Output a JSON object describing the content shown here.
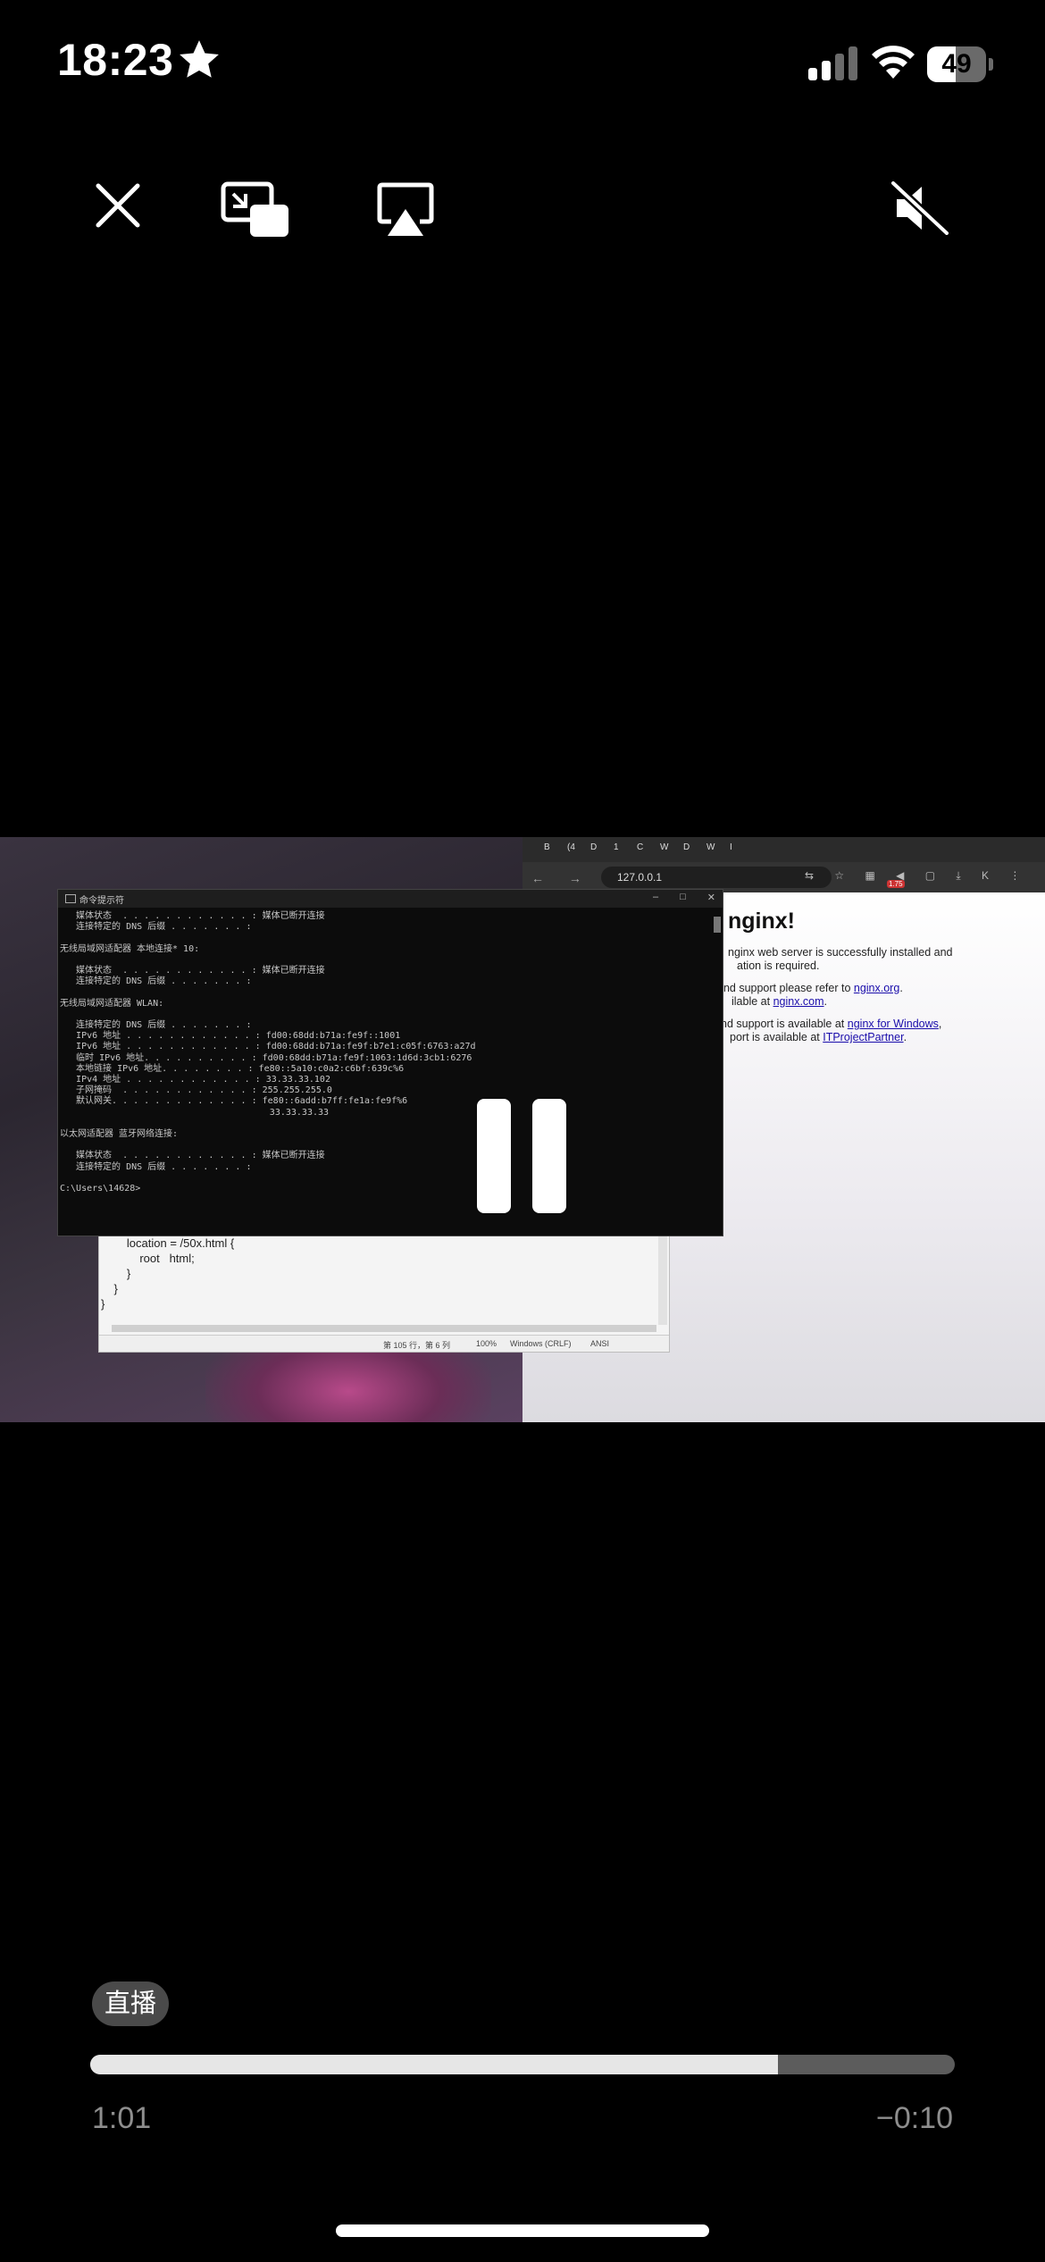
{
  "status_bar": {
    "time": "18:23",
    "focus_icon": "star-icon",
    "signal_icon": "cellular-signal-icon",
    "wifi_icon": "wifi-icon",
    "battery_level": "49",
    "battery_fraction": 0.49
  },
  "controls": {
    "close_icon": "close-icon",
    "pip_icon": "picture-in-picture-icon",
    "airplay_icon": "airplay-icon",
    "mute_icon": "speaker-muted-icon"
  },
  "video": {
    "cmd_title": "命令提示符",
    "cmd_buttons": [
      "–",
      "□",
      "✕"
    ],
    "cmd_lines": [
      "   媒体状态  . . . . . . . . . . . . : 媒体已断开连接",
      "   连接特定的 DNS 后缀 . . . . . . . :",
      "",
      "无线局域网适配器 本地连接* 10:",
      "",
      "   媒体状态  . . . . . . . . . . . . : 媒体已断开连接",
      "   连接特定的 DNS 后缀 . . . . . . . :",
      "",
      "无线局域网适配器 WLAN:",
      "",
      "   连接特定的 DNS 后缀 . . . . . . . :",
      "   IPv6 地址 . . . . . . . . . . . . : fd00:68dd:b71a:fe9f::1001",
      "   IPv6 地址 . . . . . . . . . . . . : fd00:68dd:b71a:fe9f:b7e1:c05f:6763:a27d",
      "   临时 IPv6 地址. . . . . . . . . . : fd00:68dd:b71a:fe9f:1063:1d6d:3cb1:6276",
      "   本地链接 IPv6 地址. . . . . . . . : fe80::5a10:c0a2:c6bf:639c%6",
      "   IPv4 地址 . . . . . . . . . . . . : 33.33.33.102",
      "   子网掩码  . . . . . . . . . . . . : 255.255.255.0",
      "   默认网关. . . . . . . . . . . . . : fe80::6add:b7ff:fe1a:fe9f%6",
      "                                       33.33.33.33",
      "",
      "以太网适配器 蓝牙网络连接:",
      "",
      "   媒体状态  . . . . . . . . . . . . : 媒体已断开连接",
      "   连接特定的 DNS 后缀 . . . . . . . :",
      "",
      "C:\\Users\\14628>"
    ],
    "notepad_lines": [
      "        location = /50x.html {",
      "            root   html;",
      "        }",
      "    }",
      "}"
    ],
    "notepad_status": [
      "第 105 行，第 6 列",
      "100%",
      "Windows (CRLF)",
      "ANSI"
    ],
    "browser_tabs": [
      "B",
      "(4",
      "D",
      "1",
      "C",
      "W",
      "D",
      "W",
      "I"
    ],
    "browser_url": "127.0.0.1",
    "browser_nav": "← → ⟳ ⓘ",
    "browser_ext": "⇆ ☆ ▦ ◀ ▢ ⤓ K ⋮",
    "browser_badge": "1.75",
    "nginx": {
      "heading": "nginx!",
      "line1": "nginx web server is successfully installed and",
      "line2": "ation is required.",
      "line3_pre": "and support please refer to ",
      "line3_link": "nginx.org",
      "line3_post": ".",
      "line4_pre": "ilable at ",
      "line4_link": "nginx.com",
      "line4_post": ".",
      "line5_pre": "nd support is available at ",
      "line5_link": "nginx for Windows",
      "line5_post": ",",
      "line6_pre": "port is available at ",
      "line6_link": "ITProjectPartner",
      "line6_post": "."
    }
  },
  "playback": {
    "live_label": "直播",
    "elapsed": "1:01",
    "remaining": "−0:10",
    "progress_fraction": 0.795
  }
}
